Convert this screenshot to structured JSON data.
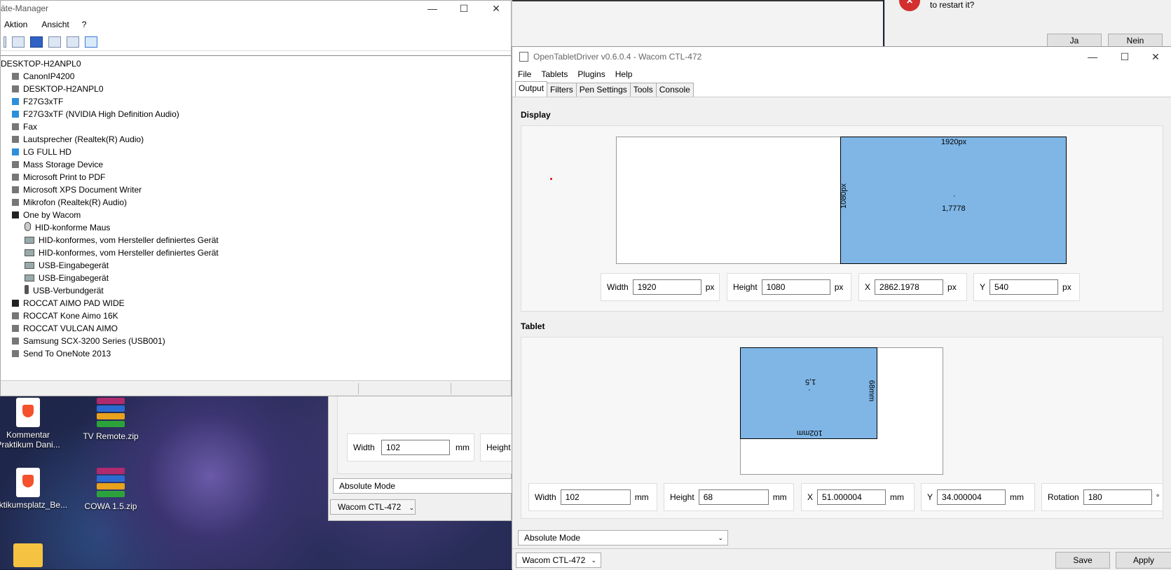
{
  "background_window": {
    "dialog_message": "to restart it?",
    "yes_label": "Ja",
    "no_label": "Nein"
  },
  "device_manager": {
    "title": "äte-Manager",
    "menu": [
      "Aktion",
      "Ansicht",
      "?"
    ],
    "tree": [
      {
        "label": "DESKTOP-H2ANPL0",
        "level": 0,
        "icon": "computer-icon"
      },
      {
        "label": "CanonIP4200",
        "level": 1,
        "icon": "printer-icon"
      },
      {
        "label": "DESKTOP-H2ANPL0",
        "level": 1,
        "icon": "computer-icon"
      },
      {
        "label": "F27G3xTF",
        "level": 1,
        "icon": "monitor-icon"
      },
      {
        "label": "F27G3xTF (NVIDIA High Definition Audio)",
        "level": 1,
        "icon": "monitor-icon"
      },
      {
        "label": "Fax",
        "level": 1,
        "icon": "printer-icon"
      },
      {
        "label": "Lautsprecher (Realtek(R) Audio)",
        "level": 1,
        "icon": "speaker-icon"
      },
      {
        "label": "LG FULL HD",
        "level": 1,
        "icon": "monitor-icon"
      },
      {
        "label": "Mass Storage Device",
        "level": 1,
        "icon": "drive-icon"
      },
      {
        "label": "Microsoft Print to PDF",
        "level": 1,
        "icon": "printer-icon"
      },
      {
        "label": "Microsoft XPS Document Writer",
        "level": 1,
        "icon": "printer-icon"
      },
      {
        "label": "Mikrofon (Realtek(R) Audio)",
        "level": 1,
        "icon": "microphone-icon"
      },
      {
        "label": "One by Wacom",
        "level": 1,
        "icon": "tablet-icon"
      },
      {
        "label": "HID-konforme Maus",
        "level": 2,
        "icon": "mouse-icon"
      },
      {
        "label": "HID-konformes, vom Hersteller definiertes Gerät",
        "level": 2,
        "icon": "hid-device-icon"
      },
      {
        "label": "HID-konformes, vom Hersteller definiertes Gerät",
        "level": 2,
        "icon": "hid-device-icon"
      },
      {
        "label": "USB-Eingabegerät",
        "level": 2,
        "icon": "hid-device-icon"
      },
      {
        "label": "USB-Eingabegerät",
        "level": 2,
        "icon": "hid-device-icon"
      },
      {
        "label": "USB-Verbundgerät",
        "level": 2,
        "icon": "usb-icon"
      },
      {
        "label": "ROCCAT AIMO PAD WIDE",
        "level": 1,
        "icon": "pad-icon"
      },
      {
        "label": "ROCCAT Kone Aimo 16K",
        "level": 1,
        "icon": "keyboard-icon"
      },
      {
        "label": "ROCCAT VULCAN AIMO",
        "level": 1,
        "icon": "keyboard-icon"
      },
      {
        "label": "Samsung SCX-3200 Series (USB001)",
        "level": 1,
        "icon": "printer-icon"
      },
      {
        "label": "Send To OneNote 2013",
        "level": 1,
        "icon": "printer-icon"
      }
    ]
  },
  "desktop": {
    "icons": [
      {
        "label": "Kommentar Praktikum Dani...",
        "icon": "brave-document-icon"
      },
      {
        "label": "TV Remote.zip",
        "icon": "winrar-archive-icon"
      },
      {
        "label": "aktikumsplatz_Be...",
        "icon": "brave-document-icon"
      },
      {
        "label": "COWA 1.5.zip",
        "icon": "winrar-archive-icon"
      },
      {
        "label": "",
        "icon": "folder-icon"
      }
    ]
  },
  "ghost_window": {
    "width_label": "Width",
    "width_value": "102",
    "unit": "mm",
    "height_label": "Height",
    "mode": "Absolute Mode",
    "tablet": "Wacom CTL-472"
  },
  "otd": {
    "title": "OpenTabletDriver v0.6.0.4 - Wacom CTL-472",
    "menu": [
      "File",
      "Tablets",
      "Plugins",
      "Help"
    ],
    "tabs": [
      "Output",
      "Filters",
      "Pen Settings",
      "Tools",
      "Console"
    ],
    "display": {
      "section_title": "Display",
      "width_label": "1920px",
      "height_label": "1080px",
      "aspect": "1,7778",
      "fields": [
        {
          "label": "Width",
          "value": "1920",
          "unit": "px"
        },
        {
          "label": "Height",
          "value": "1080",
          "unit": "px"
        },
        {
          "label": "X",
          "value": "2862.1978",
          "unit": "px"
        },
        {
          "label": "Y",
          "value": "540",
          "unit": "px"
        }
      ]
    },
    "tablet": {
      "section_title": "Tablet",
      "width_label": "102mm",
      "height_label": "68mm",
      "aspect": "1,5",
      "fields": [
        {
          "label": "Width",
          "value": "102",
          "unit": "mm"
        },
        {
          "label": "Height",
          "value": "68",
          "unit": "mm"
        },
        {
          "label": "X",
          "value": "51.000004",
          "unit": "mm"
        },
        {
          "label": "Y",
          "value": "34.000004",
          "unit": "mm"
        },
        {
          "label": "Rotation",
          "value": "180",
          "unit": "°"
        }
      ]
    },
    "mode": "Absolute Mode",
    "tablet_select": "Wacom CTL-472",
    "save_label": "Save",
    "apply_label": "Apply"
  }
}
